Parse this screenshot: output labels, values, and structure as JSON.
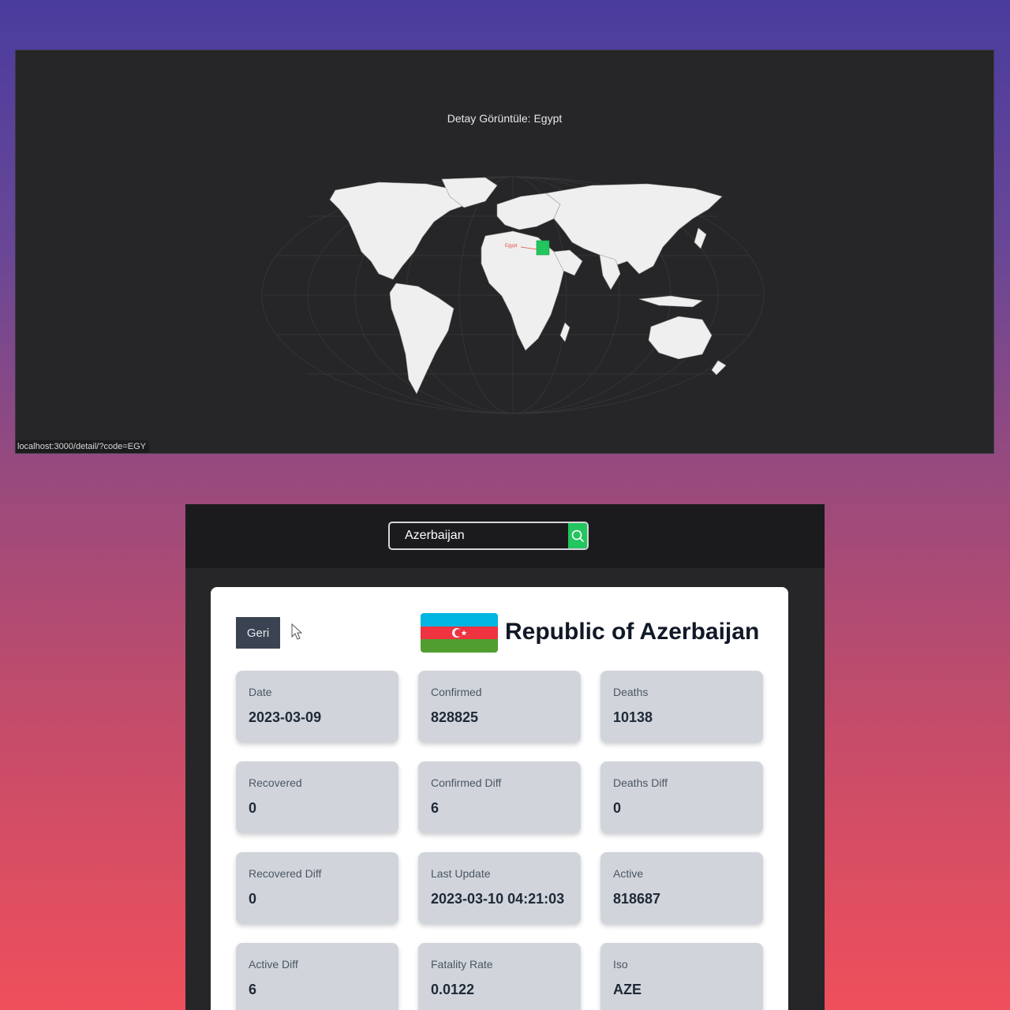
{
  "map_view": {
    "title": "Detay Görüntüle: Egypt",
    "highlight_label": "Egypt",
    "highlight_color": "#22c55e",
    "status_url": "localhost:3000/detail/?code=EGY"
  },
  "search": {
    "value": "Azerbaijan",
    "icon": "search-icon",
    "button_color": "#22c55e"
  },
  "detail": {
    "back_label": "Geri",
    "country_name": "Republic of Azerbaijan",
    "flag_colors": [
      "#00b5e2",
      "#ef3340",
      "#509e2f"
    ],
    "stats": [
      {
        "label": "Date",
        "value": "2023-03-09"
      },
      {
        "label": "Confirmed",
        "value": "828825"
      },
      {
        "label": "Deaths",
        "value": "10138"
      },
      {
        "label": "Recovered",
        "value": "0"
      },
      {
        "label": "Confirmed Diff",
        "value": "6"
      },
      {
        "label": "Deaths Diff",
        "value": "0"
      },
      {
        "label": "Recovered Diff",
        "value": "0"
      },
      {
        "label": "Last Update",
        "value": "2023-03-10 04:21:03"
      },
      {
        "label": "Active",
        "value": "818687"
      },
      {
        "label": "Active Diff",
        "value": "6"
      },
      {
        "label": "Fatality Rate",
        "value": "0.0122"
      },
      {
        "label": "Iso",
        "value": "AZE"
      }
    ]
  }
}
